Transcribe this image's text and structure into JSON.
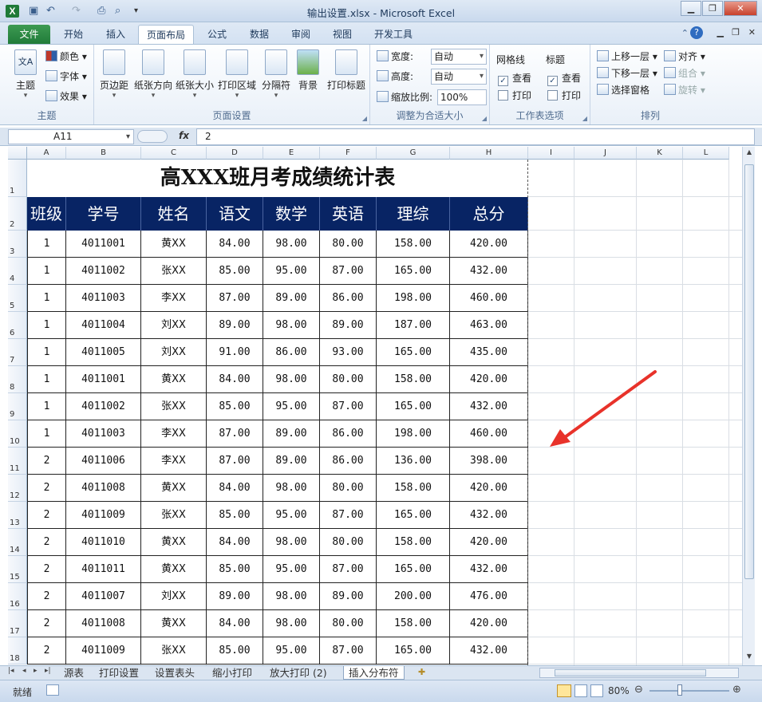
{
  "window": {
    "title": "输出设置.xlsx - Microsoft Excel",
    "app_icon": "X"
  },
  "qat": {
    "undo": "↶",
    "redo": "↷",
    "save": "▣",
    "print": "⎙",
    "preview": "⌕"
  },
  "ribbon_tabs": [
    "文件",
    "开始",
    "插入",
    "页面布局",
    "公式",
    "数据",
    "审阅",
    "视图",
    "开发工具"
  ],
  "ribbon": {
    "theme": {
      "big_label": "主题",
      "colors": "颜色",
      "fonts": "字体",
      "effects": "效果",
      "group": "主题"
    },
    "page_setup": {
      "margins": "页边距",
      "orientation": "纸张方向",
      "size": "纸张大小",
      "print_area": "打印区域",
      "breaks": "分隔符",
      "background": "背景",
      "print_titles": "打印标题",
      "group": "页面设置"
    },
    "scale": {
      "width_label": "宽度:",
      "width_value": "自动",
      "height_label": "高度:",
      "height_value": "自动",
      "scale_label": "缩放比例:",
      "scale_value": "100%",
      "group": "调整为合适大小"
    },
    "sheet_options": {
      "gridlines": "网格线",
      "headings": "标题",
      "view": "查看",
      "print": "打印",
      "group": "工作表选项"
    },
    "arrange": {
      "bring_forward": "上移一层",
      "send_backward": "下移一层",
      "selection_pane": "选择窗格",
      "align": "对齐",
      "group_obj": "组合",
      "rotate": "旋转",
      "group": "排列"
    }
  },
  "formula_bar": {
    "name_box": "A11",
    "fx": "fx",
    "value": "2"
  },
  "columns": [
    "A",
    "B",
    "C",
    "D",
    "E",
    "F",
    "G",
    "H",
    "I",
    "J",
    "K",
    "L"
  ],
  "rows": [
    "1",
    "2",
    "3",
    "4",
    "5",
    "6",
    "7",
    "8",
    "9",
    "10",
    "11",
    "12",
    "13",
    "14",
    "15",
    "16",
    "17",
    "18"
  ],
  "sheet": {
    "title": "高XXX班月考成绩统计表",
    "headers": [
      "班级",
      "学号",
      "姓名",
      "语文",
      "数学",
      "英语",
      "理综",
      "总分"
    ],
    "data": [
      [
        "1",
        "4011001",
        "黄XX",
        "84.00",
        "98.00",
        "80.00",
        "158.00",
        "420.00"
      ],
      [
        "1",
        "4011002",
        "张XX",
        "85.00",
        "95.00",
        "87.00",
        "165.00",
        "432.00"
      ],
      [
        "1",
        "4011003",
        "李XX",
        "87.00",
        "89.00",
        "86.00",
        "198.00",
        "460.00"
      ],
      [
        "1",
        "4011004",
        "刘XX",
        "89.00",
        "98.00",
        "89.00",
        "187.00",
        "463.00"
      ],
      [
        "1",
        "4011005",
        "刘XX",
        "91.00",
        "86.00",
        "93.00",
        "165.00",
        "435.00"
      ],
      [
        "1",
        "4011001",
        "黄XX",
        "84.00",
        "98.00",
        "80.00",
        "158.00",
        "420.00"
      ],
      [
        "1",
        "4011002",
        "张XX",
        "85.00",
        "95.00",
        "87.00",
        "165.00",
        "432.00"
      ],
      [
        "1",
        "4011003",
        "李XX",
        "87.00",
        "89.00",
        "86.00",
        "198.00",
        "460.00"
      ],
      [
        "2",
        "4011006",
        "李XX",
        "87.00",
        "89.00",
        "86.00",
        "136.00",
        "398.00"
      ],
      [
        "2",
        "4011008",
        "黄XX",
        "84.00",
        "98.00",
        "80.00",
        "158.00",
        "420.00"
      ],
      [
        "2",
        "4011009",
        "张XX",
        "85.00",
        "95.00",
        "87.00",
        "165.00",
        "432.00"
      ],
      [
        "2",
        "4011010",
        "黄XX",
        "84.00",
        "98.00",
        "80.00",
        "158.00",
        "420.00"
      ],
      [
        "2",
        "4011011",
        "黄XX",
        "85.00",
        "95.00",
        "87.00",
        "165.00",
        "432.00"
      ],
      [
        "2",
        "4011007",
        "刘XX",
        "89.00",
        "98.00",
        "89.00",
        "200.00",
        "476.00"
      ],
      [
        "2",
        "4011008",
        "黄XX",
        "84.00",
        "98.00",
        "80.00",
        "158.00",
        "420.00"
      ],
      [
        "2",
        "4011009",
        "张XX",
        "85.00",
        "95.00",
        "87.00",
        "165.00",
        "432.00"
      ]
    ]
  },
  "sheet_tabs": [
    "源表",
    "打印设置",
    "设置表头",
    "缩小打印",
    "放大打印 (2)",
    "插入分布符"
  ],
  "active_sheet": "插入分布符",
  "status": {
    "ready": "就绪",
    "zoom": "80%"
  },
  "colors": {
    "header_bg": "#082464",
    "arrow": "#e8322a",
    "file_tab": "#1f7a38"
  }
}
